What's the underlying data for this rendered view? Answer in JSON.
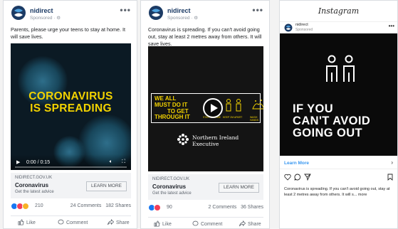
{
  "ad1": {
    "page_name": "nidirect",
    "sponsored": "Sponsored · ⚙",
    "menu": "•••",
    "caption": "Parents, please urge your teens to stay at home. It will save lives.",
    "headline_line1": "CORONAVIRUS",
    "headline_line2": "IS SPREADING",
    "video_time": "0:00 / 0:15",
    "link_domain": "NIDIRECT.GOV.UK",
    "link_title": "Coronavirus",
    "link_desc": "Get the latest advice",
    "cta": "LEARN MORE",
    "reaction_count": "210",
    "comments": "24 Comments",
    "shares": "182 Shares",
    "like": "Like",
    "comment": "Comment",
    "share": "Share"
  },
  "ad2": {
    "page_name": "nidirect",
    "sponsored": "Sponsored · ⚙",
    "menu": "•••",
    "caption": "Coronavirus is spreading. If you can't avoid going out, stay at least 2 metres away from others. It will save lives.",
    "banner_line1": "WE ALL",
    "banner_line2": "MUST DO IT",
    "banner_line3": "TO GET",
    "banner_line4": "THROUGH IT",
    "banner_small1": "STAY AT HOME",
    "banner_small2": "KEEP 2M APART",
    "banner_small3": "WASH HANDS",
    "org_line1": "Northern Ireland",
    "org_line2": "Executive",
    "link_domain": "NIDIRECT.GOV.UK",
    "link_title": "Coronavirus",
    "link_desc": "Get the latest advice",
    "cta": "LEARN MORE",
    "reaction_count": "90",
    "comments": "2 Comments",
    "shares": "36 Shares",
    "like": "Like",
    "comment": "Comment",
    "share": "Share"
  },
  "ad3": {
    "app_title": "Instagram",
    "page_name": "nidirect",
    "sponsored": "Sponsored",
    "menu": "•••",
    "headline_line1": "IF YOU",
    "headline_line2": "CAN'T AVOID",
    "headline_line3": "GOING OUT",
    "learn_more": "Learn More",
    "caption": "Coronavirus is spreading. If you can't avoid going out, stay at least 2 metres away from others. It will s... more"
  },
  "colors": {
    "facebook_blue": "#1877f2",
    "headline_yellow": "#f2d200",
    "love_red": "#f33e58",
    "instagram_link": "#3897f0"
  }
}
